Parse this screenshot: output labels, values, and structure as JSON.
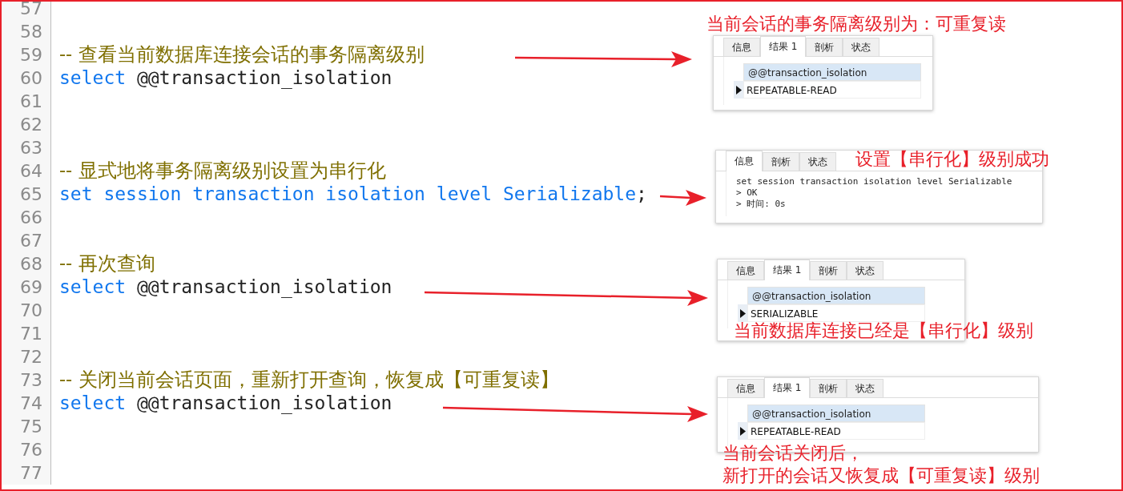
{
  "editor": {
    "lines": [
      {
        "number": "57"
      },
      {
        "number": "58"
      },
      {
        "number": "59",
        "tokens": [
          {
            "kind": "comment",
            "text": "-- 查看当前数据库连接会话的事务隔离级别"
          }
        ]
      },
      {
        "number": "60",
        "tokens": [
          {
            "kind": "keyword",
            "text": "select"
          },
          {
            "kind": "plain",
            "text": " @@transaction_isolation"
          }
        ]
      },
      {
        "number": "61"
      },
      {
        "number": "62"
      },
      {
        "number": "63"
      },
      {
        "number": "64",
        "tokens": [
          {
            "kind": "comment",
            "text": "-- 显式地将事务隔离级别设置为串行化"
          }
        ]
      },
      {
        "number": "65",
        "tokens": [
          {
            "kind": "keyword",
            "text": "set session transaction isolation level Serializable"
          },
          {
            "kind": "plain",
            "text": ";"
          }
        ]
      },
      {
        "number": "66"
      },
      {
        "number": "67"
      },
      {
        "number": "68",
        "tokens": [
          {
            "kind": "comment",
            "text": "-- 再次查询"
          }
        ]
      },
      {
        "number": "69",
        "tokens": [
          {
            "kind": "keyword",
            "text": "select"
          },
          {
            "kind": "plain",
            "text": " @@transaction_isolation"
          }
        ]
      },
      {
        "number": "70"
      },
      {
        "number": "71"
      },
      {
        "number": "72"
      },
      {
        "number": "73",
        "tokens": [
          {
            "kind": "comment",
            "text": "-- 关闭当前会话页面，重新打开查询，恢复成【可重复读】"
          }
        ]
      },
      {
        "number": "74",
        "tokens": [
          {
            "kind": "keyword",
            "text": "select"
          },
          {
            "kind": "plain",
            "text": " @@transaction_isolation"
          }
        ]
      },
      {
        "number": "75"
      },
      {
        "number": "76"
      },
      {
        "number": "77"
      }
    ]
  },
  "annotations": [
    {
      "caption": [
        "当前会话的事务隔离级别为：可重复读"
      ],
      "panel": {
        "kind": "result",
        "tabs": [
          {
            "label": "信息",
            "selected": false
          },
          {
            "label": "结果 1",
            "selected": true
          },
          {
            "label": "剖析",
            "selected": false
          },
          {
            "label": "状态",
            "selected": false
          }
        ],
        "column": "@@transaction_isolation",
        "value": "REPEATABLE-READ"
      }
    },
    {
      "caption": [
        "设置【串行化】级别成功"
      ],
      "panel": {
        "kind": "message",
        "tabs": [
          {
            "label": "信息",
            "selected": true
          },
          {
            "label": "剖析",
            "selected": false
          },
          {
            "label": "状态",
            "selected": false
          }
        ],
        "lines": [
          "set session transaction isolation level Serializable",
          "> OK",
          "> 时间: 0s"
        ]
      }
    },
    {
      "caption": [
        "当前数据库连接已经是【串行化】级别"
      ],
      "panel": {
        "kind": "result",
        "tabs": [
          {
            "label": "信息",
            "selected": false
          },
          {
            "label": "结果 1",
            "selected": true
          },
          {
            "label": "剖析",
            "selected": false
          },
          {
            "label": "状态",
            "selected": false
          }
        ],
        "column": "@@transaction_isolation",
        "value": "SERIALIZABLE"
      }
    },
    {
      "caption": [
        "当前会话关闭后，",
        "新打开的会话又恢复成【可重复读】级别"
      ],
      "panel": {
        "kind": "result",
        "tabs": [
          {
            "label": "信息",
            "selected": false
          },
          {
            "label": "结果 1",
            "selected": true
          },
          {
            "label": "剖析",
            "selected": false
          },
          {
            "label": "状态",
            "selected": false
          }
        ],
        "column": "@@transaction_isolation",
        "value": "REPEATABLE-READ"
      }
    }
  ]
}
